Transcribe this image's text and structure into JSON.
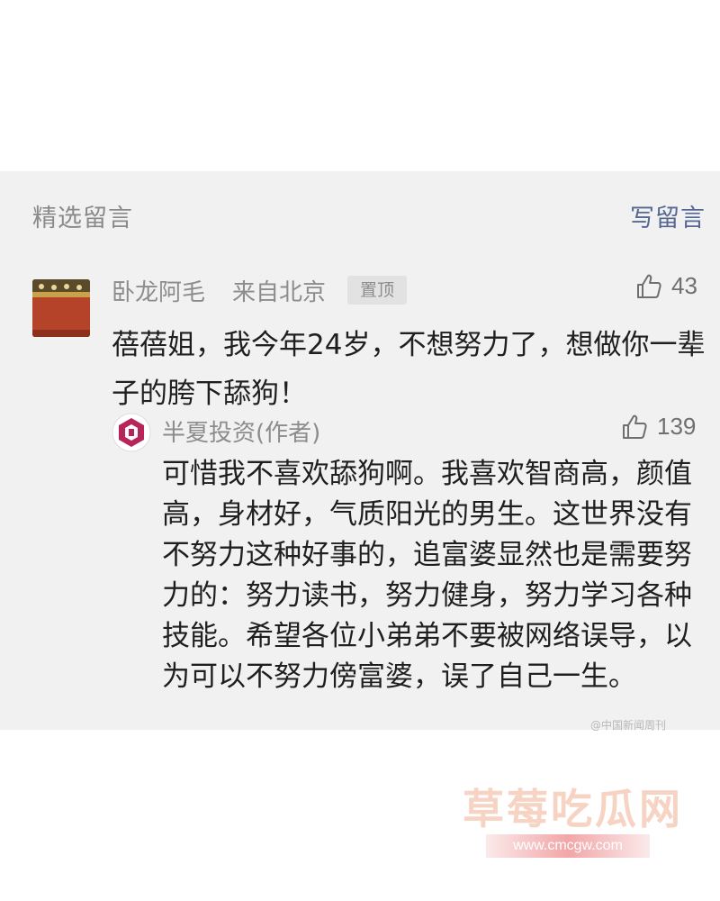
{
  "section": {
    "title": "精选留言",
    "write_label": "写留言"
  },
  "comment": {
    "author": "卧龙阿毛",
    "location": "来自北京",
    "badge": "置顶",
    "likes": "43",
    "text": "蓓蓓姐，我今年24岁，不想努力了，想做你一辈子的胯下舔狗！",
    "avatar_icon": "palace-wall-avatar"
  },
  "reply": {
    "author": "半夏投资(作者)",
    "likes": "139",
    "text": "可惜我不喜欢舔狗啊。我喜欢智商高，颜值高，身材好，气质阳光的男生。这世界没有不努力这种好事的，追富婆显然也是需要努力的：努力读书，努力健身，努力学习各种技能。希望各位小弟弟不要被网络误导，以为可以不努力傍富婆，误了自己一生。",
    "avatar_icon": "hexagon-logo-avatar"
  },
  "watermark": {
    "small": "@中国新闻周刊"
  },
  "site": {
    "brand": "草莓吃瓜网",
    "url": "www.cmcgw.com"
  },
  "colors": {
    "panel_bg": "#f1f1f1",
    "link_blue": "#566891",
    "muted_text": "#8c8c8c",
    "body_text": "#1f1f1f",
    "brand_pink": "#f6d3c2"
  }
}
